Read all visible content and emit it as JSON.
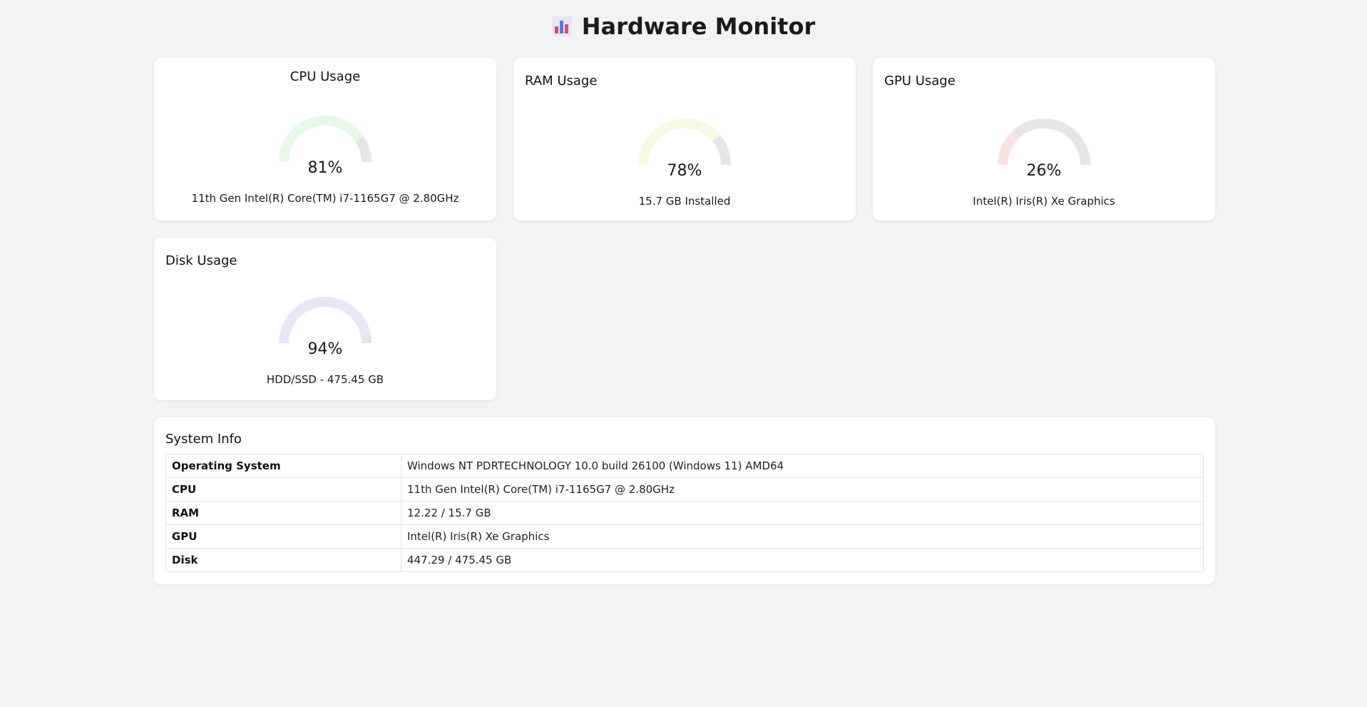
{
  "header": {
    "title": "Hardware Monitor",
    "icon": "bar-chart-icon"
  },
  "cards": {
    "cpu": {
      "title": "CPU Usage",
      "value": "81%",
      "percent": 81,
      "subtitle": "11th Gen Intel(R) Core(TM) i7-1165G7 @ 2.80GHz",
      "color": "#e6f8e6"
    },
    "ram": {
      "title": "RAM Usage",
      "value": "78%",
      "percent": 78,
      "subtitle": "15.7 GB Installed",
      "color": "#f6fae0"
    },
    "gpu": {
      "title": "GPU Usage",
      "value": "26%",
      "percent": 26,
      "subtitle": "Intel(R) Iris(R) Xe Graphics",
      "color": "#fbe2e2"
    },
    "disk": {
      "title": "Disk Usage",
      "value": "94%",
      "percent": 94,
      "subtitle": "HDD/SSD - 475.45 GB",
      "color": "#ebe6f7"
    }
  },
  "gauge_track_color": "#e6e6e9",
  "system_info": {
    "title": "System Info",
    "rows": [
      {
        "label": "Operating System",
        "value": "Windows NT PDRTECHNOLOGY 10.0 build 26100 (Windows 11) AMD64"
      },
      {
        "label": "CPU",
        "value": "11th Gen Intel(R) Core(TM) i7-1165G7 @ 2.80GHz"
      },
      {
        "label": "RAM",
        "value": "12.22 / 15.7 GB"
      },
      {
        "label": "GPU",
        "value": "Intel(R) Iris(R) Xe Graphics"
      },
      {
        "label": "Disk",
        "value": "447.29 / 475.45 GB"
      }
    ]
  }
}
